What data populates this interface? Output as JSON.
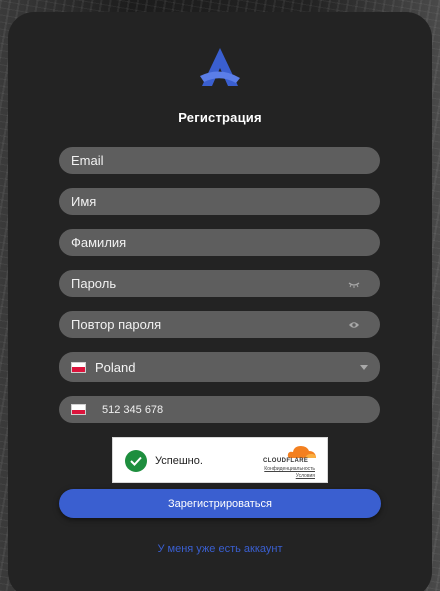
{
  "app": {
    "title": "Регистрация",
    "logo_icon": "brand-a-logo-icon",
    "accent": "#3a5fd0"
  },
  "form": {
    "email": {
      "placeholder": "Email"
    },
    "first_name": {
      "placeholder": "Имя"
    },
    "last_name": {
      "placeholder": "Фамилия"
    },
    "password": {
      "placeholder": "Пароль",
      "icon": "eye-closed-icon"
    },
    "password_repeat": {
      "placeholder": "Повтор пароля",
      "icon": "eye-icon"
    },
    "country": {
      "value": "Poland",
      "flag": "poland-flag-icon"
    },
    "phone": {
      "value": "512 345 678",
      "flag": "poland-flag-icon"
    }
  },
  "captcha": {
    "status": "Успешно.",
    "brand": "CLOUDFLARE",
    "privacy_link": "Конфиденциальность",
    "terms_link": "Условия",
    "status_color": "#1e8e3e"
  },
  "actions": {
    "submit_label": "Зарегистрироваться",
    "login_link": "У меня уже есть аккаунт"
  }
}
